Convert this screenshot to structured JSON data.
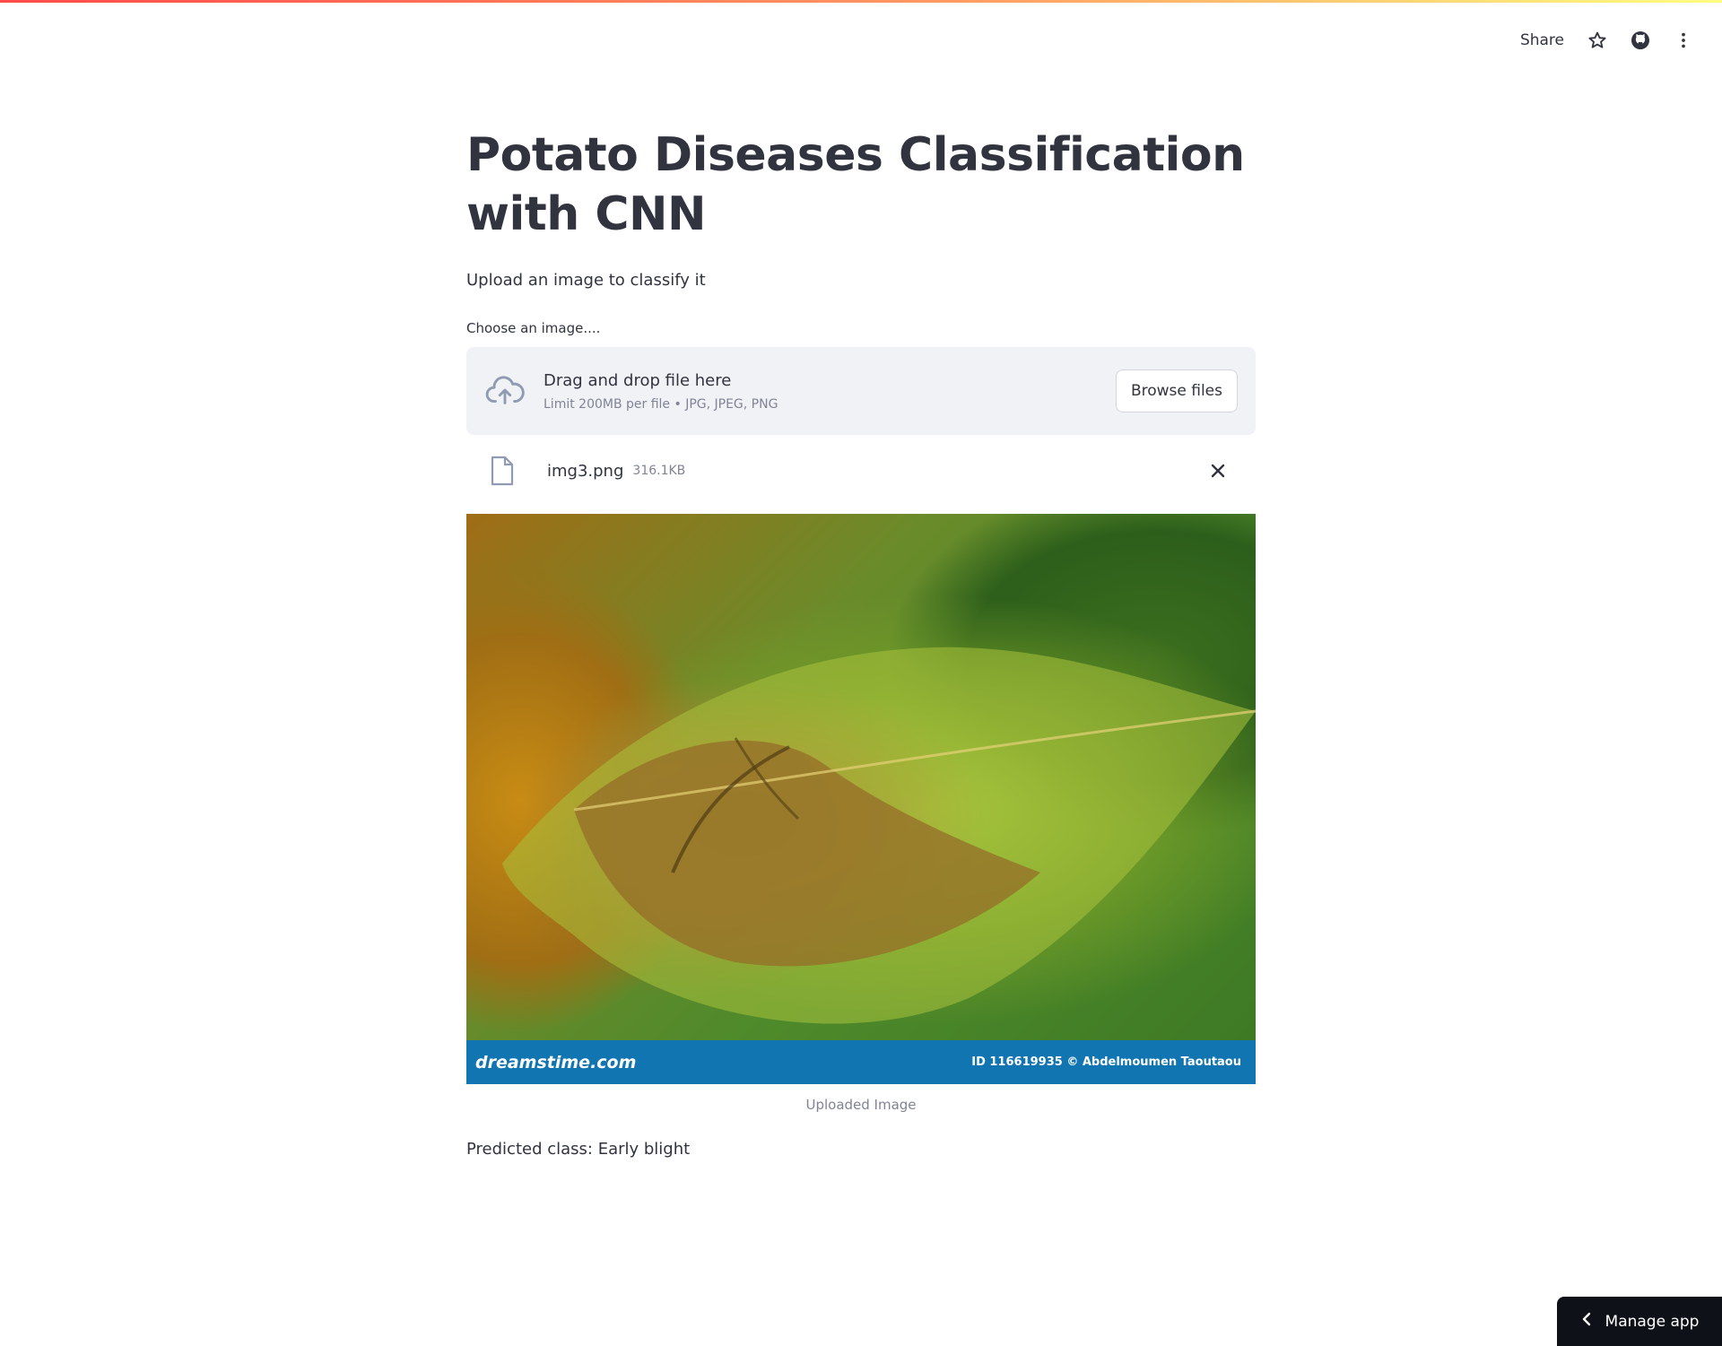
{
  "header": {
    "share_label": "Share",
    "icons": [
      "star-icon",
      "github-icon",
      "more-vert-icon"
    ]
  },
  "main": {
    "title": "Potato Diseases Classification with CNN",
    "subtitle": "Upload an image to classify it",
    "uploader": {
      "label": "Choose an image....",
      "drop_text": "Drag and drop file here",
      "limit_text": "Limit 200MB per file • JPG, JPEG, PNG",
      "browse_label": "Browse files"
    },
    "uploaded_file": {
      "name": "img3.png",
      "size": "316.1KB"
    },
    "image": {
      "banner_logo": "dreamstime.com",
      "banner_id": "ID 116619935 © Abdelmoumen Taoutaou",
      "caption": "Uploaded Image"
    },
    "prediction": "Predicted class: Early blight"
  },
  "footer": {
    "manage_app_label": "Manage app"
  },
  "colors": {
    "accent_gradient_start": "#ff4b4b",
    "accent_gradient_end": "#fffd80",
    "text": "#31333F",
    "muted_text": "#808495",
    "dropzone_bg": "#F0F2F6",
    "banner_bg": "#1175b2",
    "manage_app_bg": "#0E1117"
  }
}
